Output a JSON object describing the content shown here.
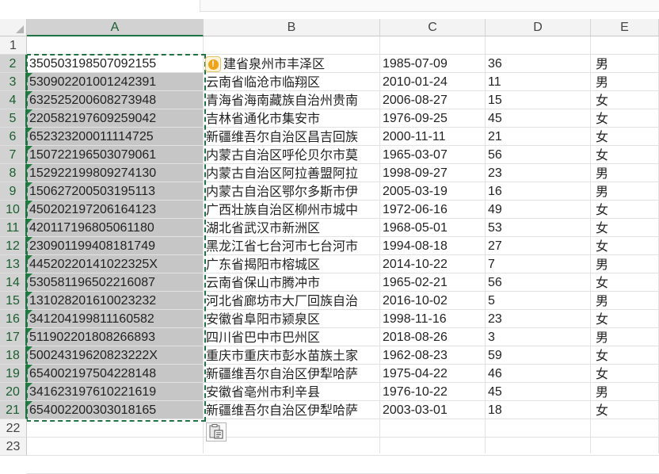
{
  "columns": [
    "A",
    "B",
    "C",
    "D",
    "E"
  ],
  "row_numbers": [
    "1",
    "2",
    "3",
    "4",
    "5",
    "6",
    "7",
    "8",
    "9",
    "10",
    "11",
    "12",
    "13",
    "14",
    "15",
    "16",
    "17",
    "18",
    "19",
    "20",
    "21",
    "22",
    "23"
  ],
  "rows": [
    {
      "id": "350503198507092155",
      "addr": "建省泉州市丰泽区",
      "date": "1985-07-09",
      "age": "36",
      "sex": "男"
    },
    {
      "id": "530902201001242391",
      "addr": "云南省临沧市临翔区",
      "date": "2010-01-24",
      "age": "11",
      "sex": "男"
    },
    {
      "id": "632525200608273948",
      "addr": "青海省海南藏族自治州贵南",
      "date": "2006-08-27",
      "age": "15",
      "sex": "女"
    },
    {
      "id": "220582197609259042",
      "addr": "吉林省通化市集安市",
      "date": "1976-09-25",
      "age": "45",
      "sex": "女"
    },
    {
      "id": "652323200011114725",
      "addr": "新疆维吾尔自治区昌吉回族",
      "date": "2000-11-11",
      "age": "21",
      "sex": "女"
    },
    {
      "id": "150722196503079061",
      "addr": "内蒙古自治区呼伦贝尔市莫",
      "date": "1965-03-07",
      "age": "56",
      "sex": "女"
    },
    {
      "id": "152922199809274130",
      "addr": "内蒙古自治区阿拉善盟阿拉",
      "date": "1998-09-27",
      "age": "23",
      "sex": "男"
    },
    {
      "id": "150627200503195113",
      "addr": "内蒙古自治区鄂尔多斯市伊",
      "date": "2005-03-19",
      "age": "16",
      "sex": "男"
    },
    {
      "id": "450202197206164123",
      "addr": "广西壮族自治区柳州市城中",
      "date": "1972-06-16",
      "age": "49",
      "sex": "女"
    },
    {
      "id": "420117196805061180",
      "addr": "湖北省武汉市新洲区",
      "date": "1968-05-01",
      "age": "53",
      "sex": "女"
    },
    {
      "id": "230901199408181749",
      "addr": "黑龙江省七台河市七台河市",
      "date": "1994-08-18",
      "age": "27",
      "sex": "女"
    },
    {
      "id": "44520220141022325X",
      "addr": "广东省揭阳市榕城区",
      "date": "2014-10-22",
      "age": "7",
      "sex": "男"
    },
    {
      "id": "530581196502216087",
      "addr": "云南省保山市腾冲市",
      "date": "1965-02-21",
      "age": "56",
      "sex": "女"
    },
    {
      "id": "131028201610023232",
      "addr": "河北省廊坊市大厂回族自治",
      "date": "2016-10-02",
      "age": "5",
      "sex": "男"
    },
    {
      "id": "341204199811160582",
      "addr": "安徽省阜阳市颍泉区",
      "date": "1998-11-16",
      "age": "23",
      "sex": "女"
    },
    {
      "id": "511902201808266893",
      "addr": "四川省巴中市巴州区",
      "date": "2018-08-26",
      "age": "3",
      "sex": "男"
    },
    {
      "id": "50024319620823222X",
      "addr": "重庆市重庆市彭水苗族土家",
      "date": "1962-08-23",
      "age": "59",
      "sex": "女"
    },
    {
      "id": "654002197504228148",
      "addr": "新疆维吾尔自治区伊犁哈萨",
      "date": "1975-04-22",
      "age": "46",
      "sex": "女"
    },
    {
      "id": "341623197610221619",
      "addr": "安徽省亳州市利辛县",
      "date": "1976-10-22",
      "age": "45",
      "sex": "男"
    },
    {
      "id": "654002200303018165",
      "addr": "新疆维吾尔自治区伊犁哈萨",
      "date": "2003-03-01",
      "age": "18",
      "sex": "女"
    }
  ],
  "icons": {
    "error_indicator": "warning-circle-icon",
    "paste_options": "paste-options-icon",
    "select_all": "select-all-triangle-icon"
  },
  "colors": {
    "accent": "#217346",
    "selection": "#c6c6c6",
    "warning": "#f0a318"
  }
}
